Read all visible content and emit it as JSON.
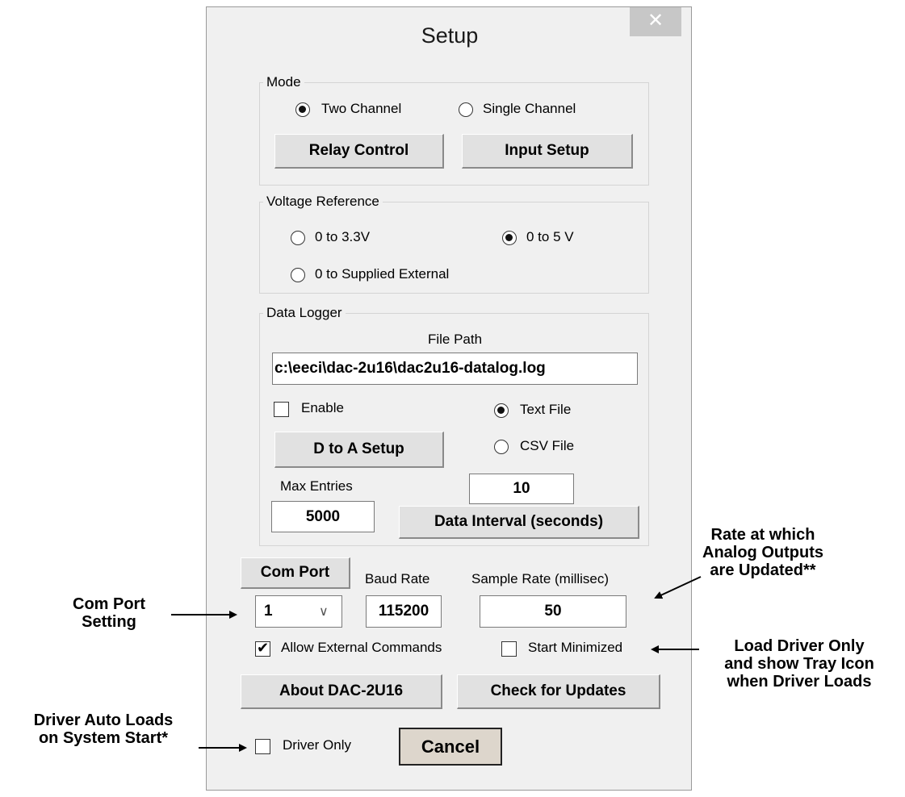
{
  "window": {
    "title": "Setup",
    "close_label": "✕"
  },
  "mode": {
    "legend": "Mode",
    "two_channel_label": "Two Channel",
    "single_channel_label": "Single Channel",
    "selected": "two_channel",
    "relay_control_label": "Relay Control",
    "input_setup_label": "Input Setup"
  },
  "voltage_reference": {
    "legend": "Voltage Reference",
    "option_33_label": "0 to 3.3V",
    "option_5_label": "0 to 5 V",
    "option_ext_label": "0 to Supplied External",
    "selected": "0_to_5V"
  },
  "data_logger": {
    "legend": "Data Logger",
    "file_path_label": "File Path",
    "file_path_value": "c:\\eeci\\dac-2u16\\dac2u16-datalog.log",
    "enable_label": "Enable",
    "enable_checked": false,
    "text_file_label": "Text File",
    "csv_file_label": "CSV File",
    "format_selected": "text",
    "d_to_a_setup_label": "D to A Setup",
    "max_entries_label": "Max Entries",
    "max_entries_value": "5000",
    "data_interval_value": "10",
    "data_interval_label": "Data Interval (seconds)"
  },
  "comms": {
    "com_port_button_label": "Com Port",
    "com_port_value": "1",
    "baud_rate_label": "Baud Rate",
    "baud_rate_value": "115200",
    "sample_rate_label": "Sample Rate (millisec)",
    "sample_rate_value": "50",
    "allow_external_label": "Allow External Commands",
    "allow_external_checked": true,
    "start_minimized_label": "Start Minimized",
    "start_minimized_checked": false
  },
  "actions": {
    "about_label": "About DAC-2U16",
    "check_updates_label": "Check for Updates",
    "driver_only_label": "Driver Only",
    "driver_only_checked": false,
    "cancel_label": "Cancel"
  },
  "annotations": {
    "rate_line1": "Rate at which",
    "rate_line2": "Analog Outputs",
    "rate_line3": "are Updated**",
    "com_line1": "Com Port",
    "com_line2": "Setting",
    "load_line1": "Load Driver Only",
    "load_line2": "and show Tray Icon",
    "load_line3": "when Driver Loads",
    "auto_line1": "Driver Auto Loads",
    "auto_line2": "on System Start*"
  },
  "colors": {
    "window_bg": "#f0f0f0",
    "button_bg": "#e1e1e1",
    "close_bg": "#c7c7c7"
  }
}
